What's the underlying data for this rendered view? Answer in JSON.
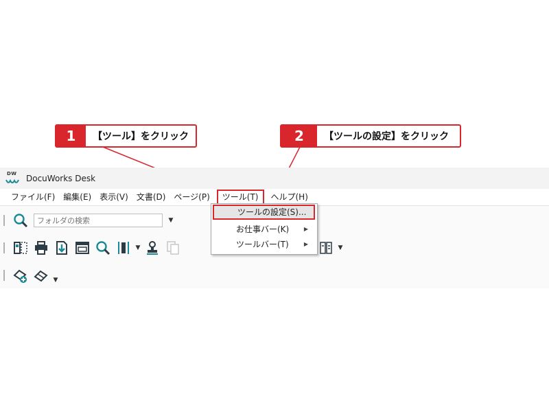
{
  "callouts": [
    {
      "number": "1",
      "text": "【ツール】をクリック"
    },
    {
      "number": "2",
      "text": "【ツールの設定】をクリック"
    }
  ],
  "window": {
    "logo_text": "DW",
    "title": "DocuWorks Desk"
  },
  "menubar": {
    "items": [
      {
        "label": "ファイル(F)"
      },
      {
        "label": "編集(E)"
      },
      {
        "label": "表示(V)"
      },
      {
        "label": "文書(D)"
      },
      {
        "label": "ページ(P)"
      },
      {
        "label": "ツール(T)"
      },
      {
        "label": "ヘルプ(H)"
      }
    ]
  },
  "toolbar": {
    "folder_search_placeholder": "フォルダの検索",
    "row2_icons": [
      "split-view-icon",
      "print-icon",
      "import-icon",
      "viewer-window-icon",
      "search-icon",
      "binder-icon",
      "stamp-icon",
      "copy-icon",
      "columns-icon"
    ],
    "row3_icons": [
      "new-annotation-icon",
      "eraser-icon"
    ]
  },
  "dropdown": {
    "items": [
      {
        "label": "ツールの設定(S)...",
        "submenu": false
      },
      {
        "label": "お仕事バー(K)",
        "submenu": true
      },
      {
        "label": "ツールバー(T)",
        "submenu": true
      }
    ]
  },
  "colors": {
    "accent_red": "#d9262c",
    "icon_teal": "#1a8a96",
    "icon_dark": "#2d3b44"
  }
}
